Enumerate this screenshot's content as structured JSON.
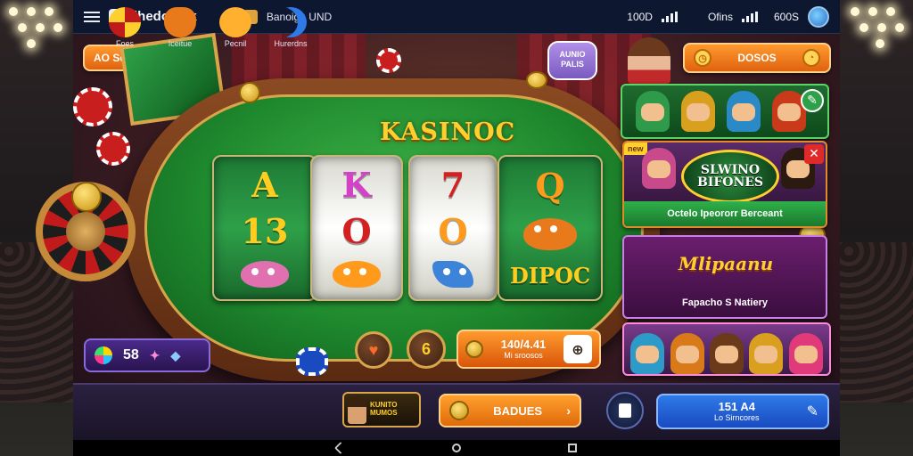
{
  "status_bar": {
    "app_title": "lhedonátk",
    "game_title": "Banoig : UND",
    "left_value": "100D",
    "center_value": "Ofins",
    "right_value": "600S"
  },
  "top": {
    "left_pill_label": "AO Sene Drasin",
    "right_pill_label": "DOSOS",
    "speech_bubble": "AUNIO PALIS",
    "table_title": "KASINOC"
  },
  "reels": [
    {
      "top": "A",
      "mid": "13",
      "bottom": "critter"
    },
    {
      "top": "K",
      "mid": "O",
      "bottom": "critter"
    },
    {
      "top": "7",
      "mid": "O",
      "bottom": "fish"
    },
    {
      "top": "Q",
      "mid": "critter",
      "bottom": "DIPOC"
    }
  ],
  "panels": {
    "featured_badge": "new",
    "panel2_logo": "SLWINO BIFONES",
    "panel2_caption": "Octelo Ipeororr Berceant",
    "panel3_logo": "Mlipaanu",
    "panel3_caption": "Fapacho S Natiery"
  },
  "counter": {
    "value": "58"
  },
  "table_buttons": {
    "button_2": "6"
  },
  "bet_button": {
    "line1": "140/4.41",
    "line2": "Mi sroosos"
  },
  "bottom_nav": {
    "items": [
      {
        "label": "Foes"
      },
      {
        "label": "Iceitue"
      },
      {
        "label": "Pecnil"
      },
      {
        "label": "Hurerdns"
      }
    ],
    "promo_text": "KUNITO MUMOS",
    "badges_label": "BADUES",
    "blue_line1": "151 A4",
    "blue_line2": "Lo Sirncores"
  },
  "colors": {
    "felt": "#1f8a2e",
    "gold": "#ffcf2e",
    "orange": "#ff9a2e",
    "blue": "#2e7ae8"
  }
}
